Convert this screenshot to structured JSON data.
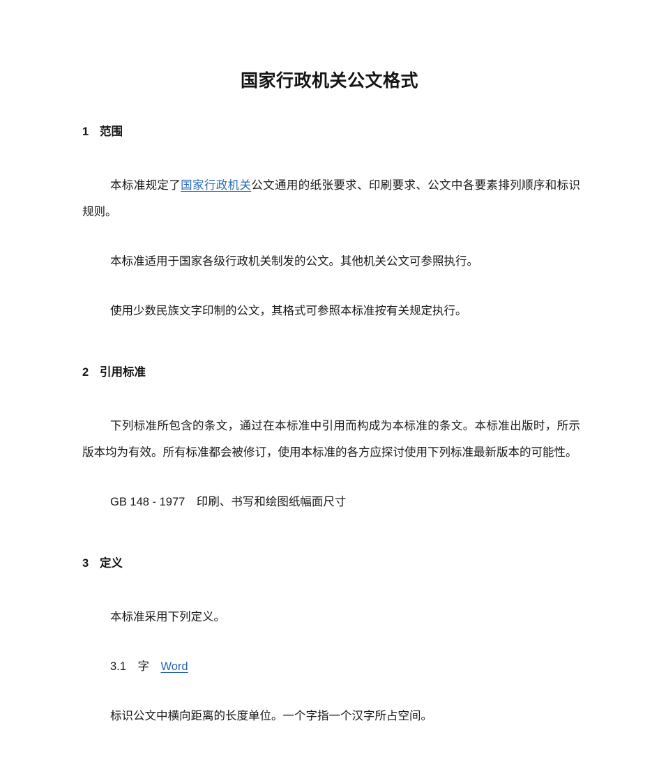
{
  "document": {
    "title": "国家行政机关公文格式",
    "link_color": "#2b6cb8",
    "text_color": "#1a1a1a"
  },
  "sections": [
    {
      "number": "1",
      "heading": "范围",
      "paragraphs": [
        {
          "lead": "本标准规定了",
          "link": "国家行政机关",
          "tail": "公文通用的纸张要求、印刷要求、公文中各要素排列顺序和标识规则。"
        },
        {
          "text": "本标准适用于国家各级行政机关制发的公文。其他机关公文可参照执行。"
        },
        {
          "text": "使用少数民族文字印制的公文，其格式可参照本标准按有关规定执行。"
        }
      ]
    },
    {
      "number": "2",
      "heading": "引用标准",
      "paragraphs": [
        {
          "text": "下列标准所包含的条文，通过在本标准中引用而构成为本标准的条文。本标准出版时，所示版本均为有效。所有标准都会被修订，使用本标准的各方应探讨使用下列标准最新版本的可能性。"
        },
        {
          "text": "GB 148 - 1977　印刷、书写和绘图纸幅面尺寸"
        }
      ]
    },
    {
      "number": "3",
      "heading": "定义",
      "paragraphs": [
        {
          "text": "本标准采用下列定义。"
        }
      ],
      "subclause": {
        "number": "3.1",
        "term": "字",
        "link": "Word",
        "definition": "标识公文中横向距离的长度单位。一个字指一个汉字所占空间。"
      }
    }
  ]
}
